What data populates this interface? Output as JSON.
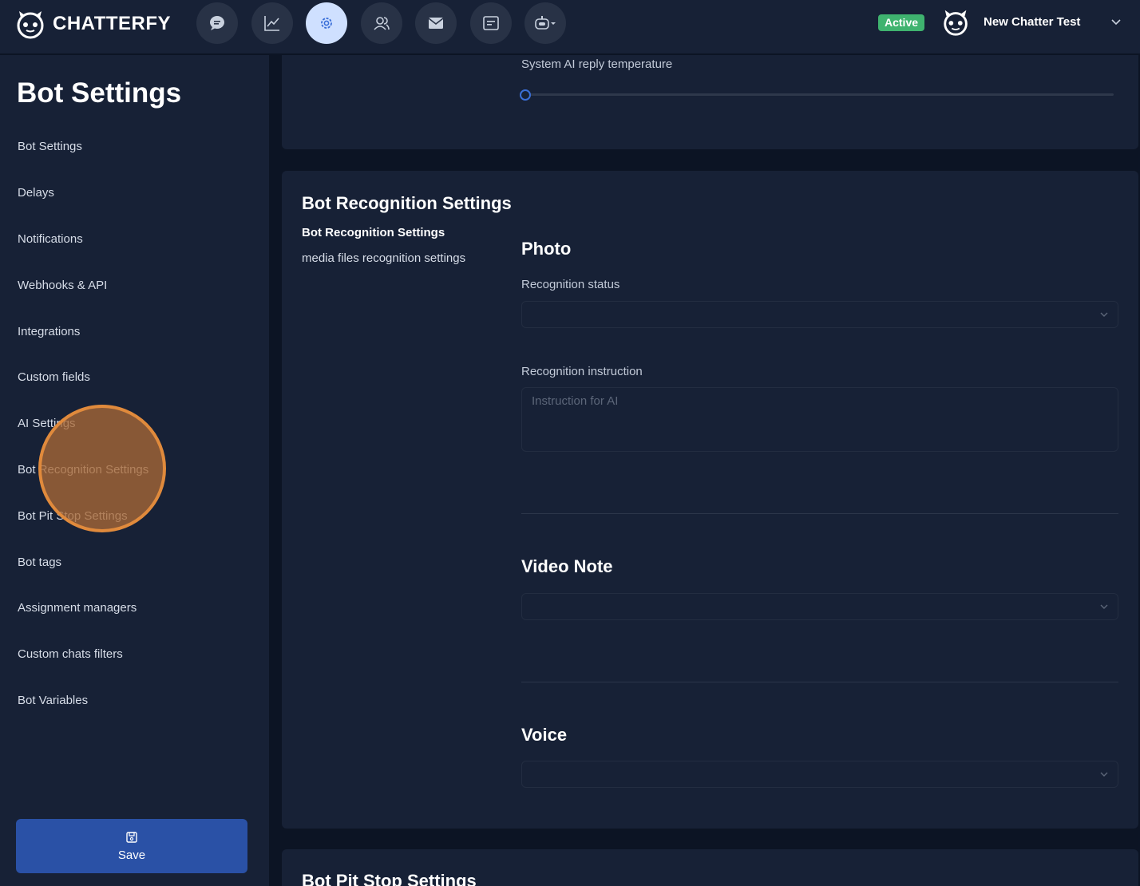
{
  "app": {
    "name": "CHATTERFY"
  },
  "nav": [
    {
      "icon": "chat-bubble-icon",
      "active": false
    },
    {
      "icon": "analytics-chart-icon",
      "active": false
    },
    {
      "icon": "settings-gear-icon",
      "active": true
    },
    {
      "icon": "users-icon",
      "active": false
    },
    {
      "icon": "mail-icon",
      "active": false
    },
    {
      "icon": "message-square-icon",
      "active": false
    },
    {
      "icon": "bot-dropdown-icon",
      "active": false
    }
  ],
  "header": {
    "status": "Active",
    "user_name": "New Chatter Test"
  },
  "sidebar": {
    "title": "Bot Settings",
    "items": [
      "Bot Settings",
      "Delays",
      "Notifications",
      "Webhooks & API",
      "Integrations",
      "Custom fields",
      "AI Settings",
      "Bot Recognition Settings",
      "Bot Pit Stop Settings",
      "Bot tags",
      "Assignment managers",
      "Custom chats filters",
      "Bot Variables"
    ],
    "save_label": "Save"
  },
  "ai_settings": {
    "temperature_label": "System AI reply temperature",
    "temperature_value": 0
  },
  "recognition": {
    "title": "Bot Recognition Settings",
    "subnav_active": "Bot Recognition Settings",
    "subnav_item": "media files recognition settings",
    "photo": {
      "title": "Photo",
      "status_label": "Recognition status",
      "status_value": "",
      "instruction_label": "Recognition instruction",
      "instruction_placeholder": "Instruction for AI"
    },
    "video_note": {
      "title": "Video Note",
      "value": ""
    },
    "voice": {
      "title": "Voice",
      "value": ""
    }
  },
  "pit_stop": {
    "title": "Bot Pit Stop Settings"
  },
  "colors": {
    "accent": "#2a51a6",
    "status": "#3fb36f",
    "nav_active": "#cfe0ff",
    "click_indicator": "#e08a3c"
  }
}
